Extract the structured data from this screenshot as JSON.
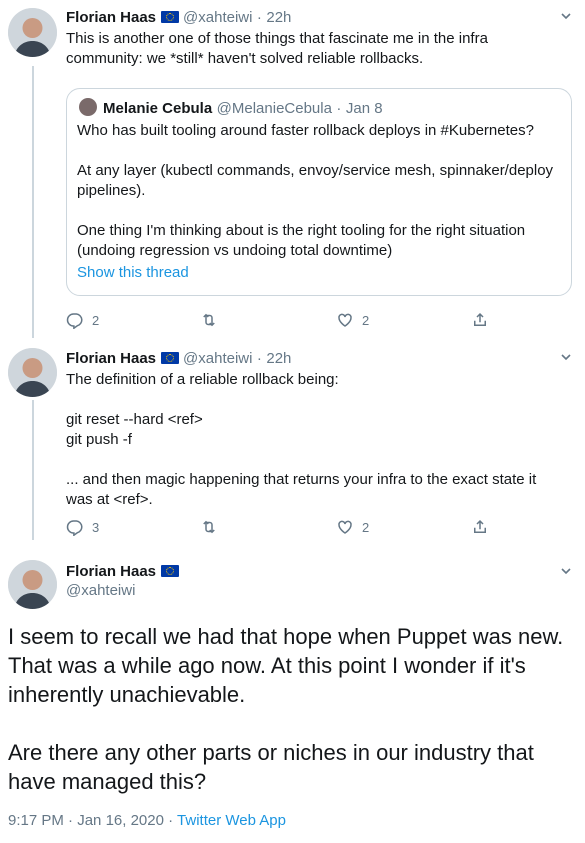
{
  "tweet1": {
    "name": "Florian Haas",
    "handle": "@xahteiwi",
    "sep": "·",
    "time": "22h",
    "text": "This is another one of those things that fascinate me in the infra community: we *still* haven't solved reliable rollbacks.",
    "quote": {
      "name": "Melanie Cebula",
      "handle": "@MelanieCebula",
      "sep": "·",
      "time": "Jan 8",
      "text": "Who has built tooling around faster rollback deploys in #Kubernetes?\n\nAt any layer (kubectl commands, envoy/service mesh, spinnaker/deploy pipelines).\n\nOne thing I'm thinking about is the right tooling for the right situation (undoing regression vs undoing total downtime)",
      "show_thread": "Show this thread"
    },
    "replies": "2",
    "likes": "2"
  },
  "tweet2": {
    "name": "Florian Haas",
    "handle": "@xahteiwi",
    "sep": "·",
    "time": "22h",
    "text": "The definition of a reliable rollback being:\n\ngit reset --hard <ref>\ngit push -f\n\n... and then magic happening that returns your infra to the exact state it was at <ref>.",
    "replies": "3",
    "likes": "2"
  },
  "tweet3": {
    "name": "Florian Haas",
    "handle": "@xahteiwi",
    "text": "I seem to recall we had that hope when Puppet was new. That was a while ago now. At this point I wonder if it's inherently unachievable.\n\nAre there any other parts or niches in our industry that have managed this?",
    "time": "9:17 PM",
    "sep": "·",
    "date": "Jan 16, 2020",
    "app": "Twitter Web App"
  },
  "colors": {
    "accent": "#1b95e0",
    "muted": "#657786",
    "border": "#ccd6dd"
  },
  "icons": [
    "reply-icon",
    "retweet-icon",
    "like-icon",
    "share-icon",
    "chevron-down-icon",
    "eu-flag-icon"
  ]
}
